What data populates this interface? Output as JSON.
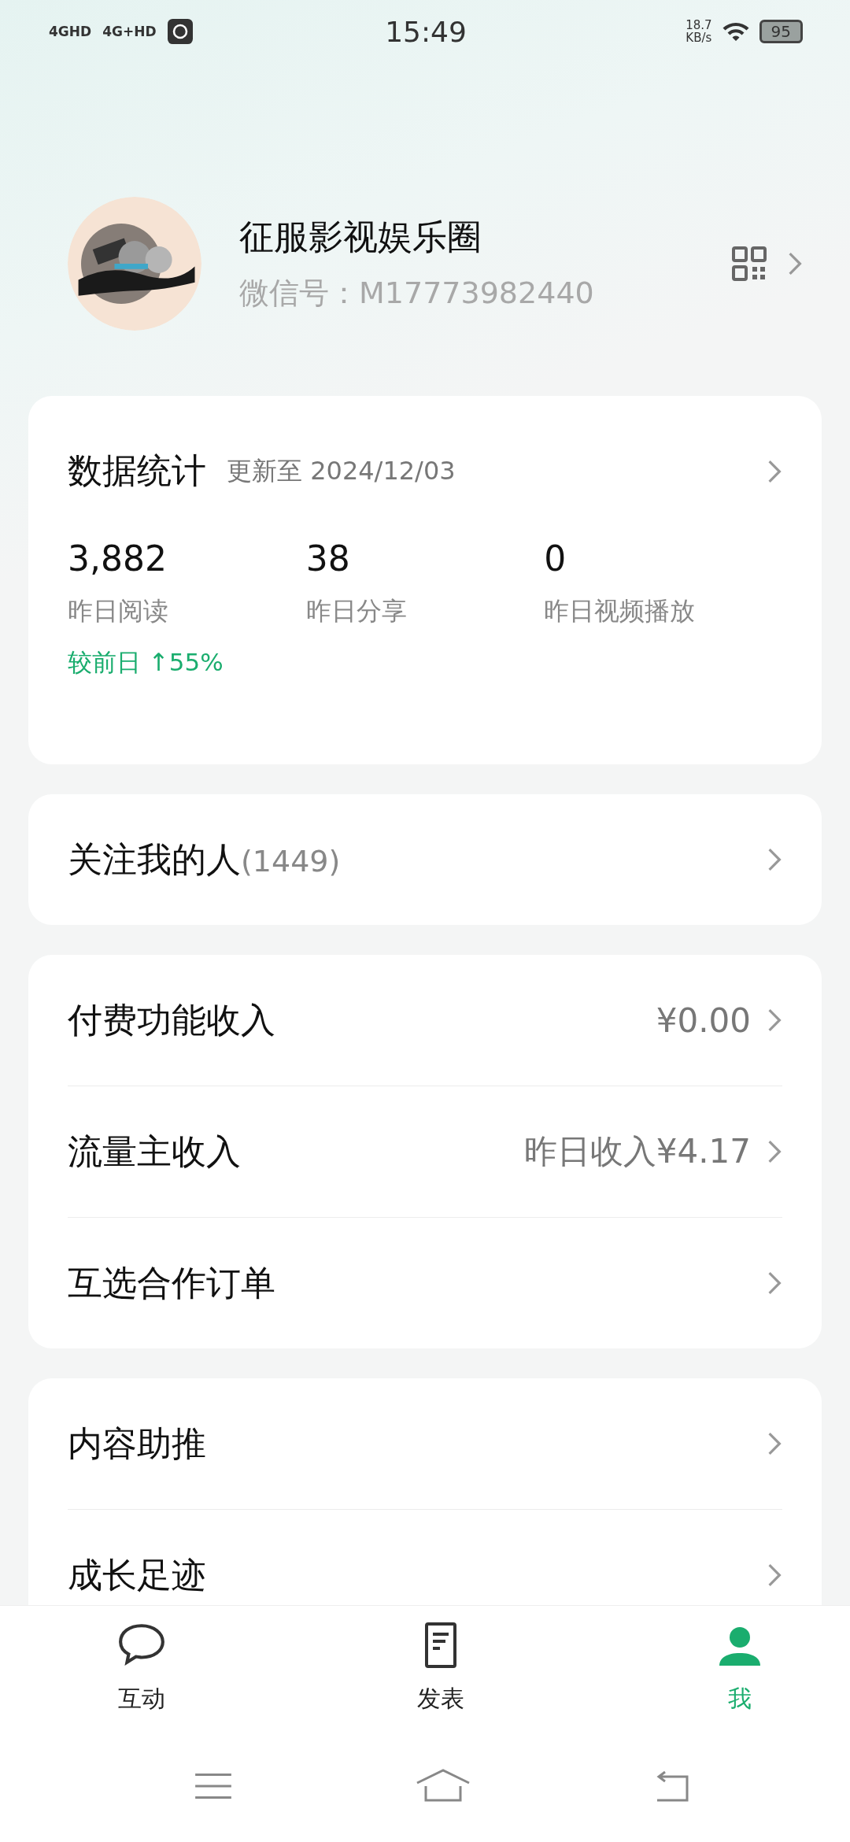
{
  "status_bar": {
    "networks": [
      "4GHD",
      "4G+HD"
    ],
    "time": "15:49",
    "speed": "18.7",
    "speed_unit": "KB/s",
    "battery": "95"
  },
  "profile": {
    "name": "征服影视娱乐圈",
    "wechat_id": "微信号：M17773982440"
  },
  "stats": {
    "title": "数据统计",
    "updated": "更新至 2024/12/03",
    "metrics": [
      {
        "value": "3,882",
        "label": "昨日阅读",
        "change": "较前日 ↑55%"
      },
      {
        "value": "38",
        "label": "昨日分享"
      },
      {
        "value": "0",
        "label": "昨日视频播放"
      }
    ]
  },
  "followers": {
    "label": "关注我的人",
    "count": "(1449)"
  },
  "groups": [
    [
      {
        "label": "付费功能收入",
        "value": "¥0.00"
      },
      {
        "label": "流量主收入",
        "value": "昨日收入¥4.17"
      },
      {
        "label": "互选合作订单"
      }
    ],
    [
      {
        "label": "内容助推"
      },
      {
        "label": "成长足迹"
      }
    ]
  ],
  "tabs": [
    {
      "label": "互动",
      "kind": "chat",
      "selected": false
    },
    {
      "label": "发表",
      "kind": "document",
      "selected": false
    },
    {
      "label": "我",
      "kind": "person",
      "selected": true
    }
  ]
}
